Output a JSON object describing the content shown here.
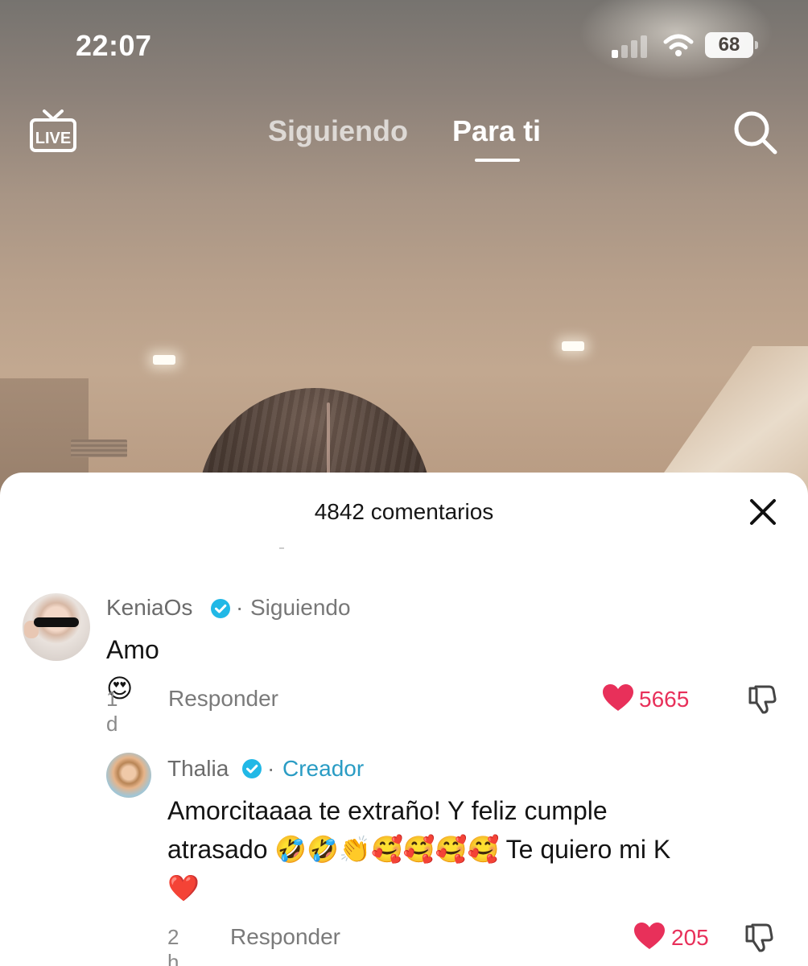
{
  "status_bar": {
    "time": "22:07",
    "battery": "68",
    "signal_icon": "cellular-signal-icon",
    "wifi_icon": "wifi-icon"
  },
  "top_nav": {
    "live_label": "LIVE",
    "tabs": [
      {
        "label": "Siguiendo",
        "active": false
      },
      {
        "label": "Para ti",
        "active": true
      }
    ],
    "search_icon": "search-icon"
  },
  "comments_sheet": {
    "title": "4842 comentarios",
    "close_icon": "close-icon",
    "comments": [
      {
        "username": "KeniaOs",
        "verified": true,
        "relation": "Siguiendo",
        "text": "Amo",
        "emoji": "😍",
        "time": "1 d",
        "reply_label": "Responder",
        "likes": "5665"
      },
      {
        "username": "Thalia",
        "verified": true,
        "relation": "Creador",
        "text_line1": "Amorcitaaaa te extraño! Y feliz cumple",
        "text_line2_prefix": "atrasado",
        "text_line2_emojis": "🤣🤣👏🥰🥰🥰🥰",
        "text_line2_suffix": "Te quiero mi K",
        "text_line3": "❤️",
        "time": "2 h",
        "reply_label": "Responder",
        "likes": "205"
      }
    ]
  },
  "colors": {
    "like": "#e8305a",
    "creator": "#2a9cc4",
    "verified": "#21b8e6"
  }
}
